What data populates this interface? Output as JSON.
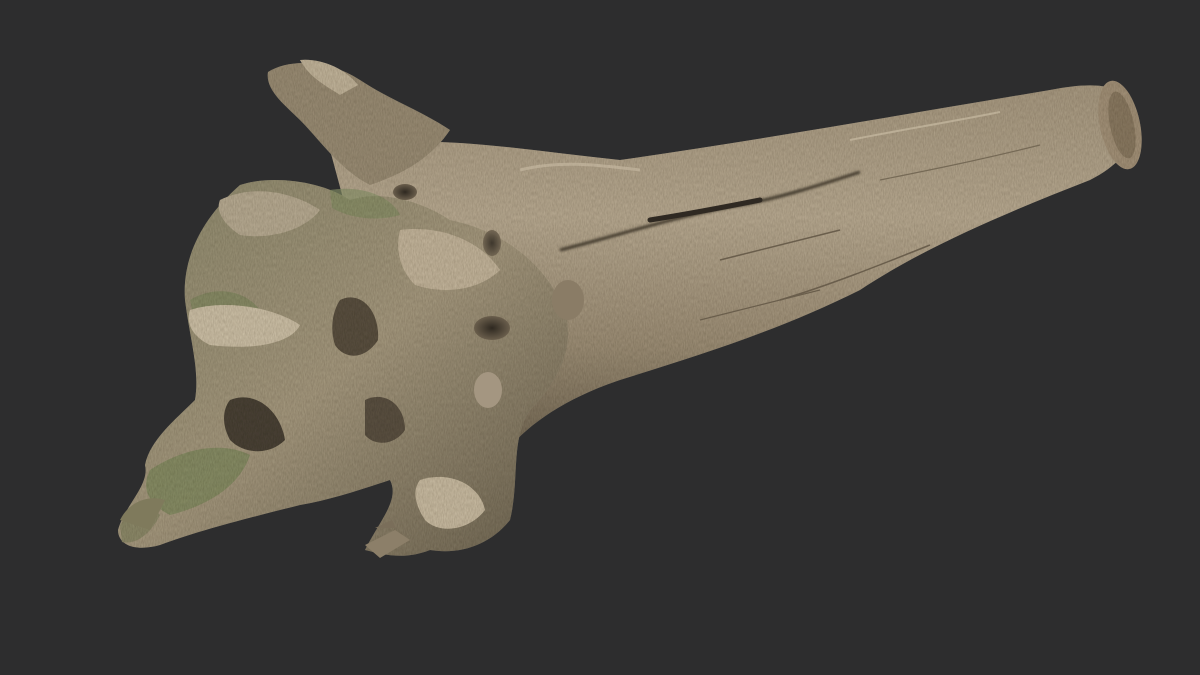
{
  "scene": {
    "background_color": "#2d2d2e",
    "subject": "driftwood-stump-3d-scan",
    "colors": {
      "bark_light": "#b8aa92",
      "bark_mid": "#9a8c74",
      "bark_dark": "#5e5444",
      "moss": "#7e8a5e",
      "shadow": "#3a342c",
      "highlight": "#d8ccb4"
    }
  }
}
